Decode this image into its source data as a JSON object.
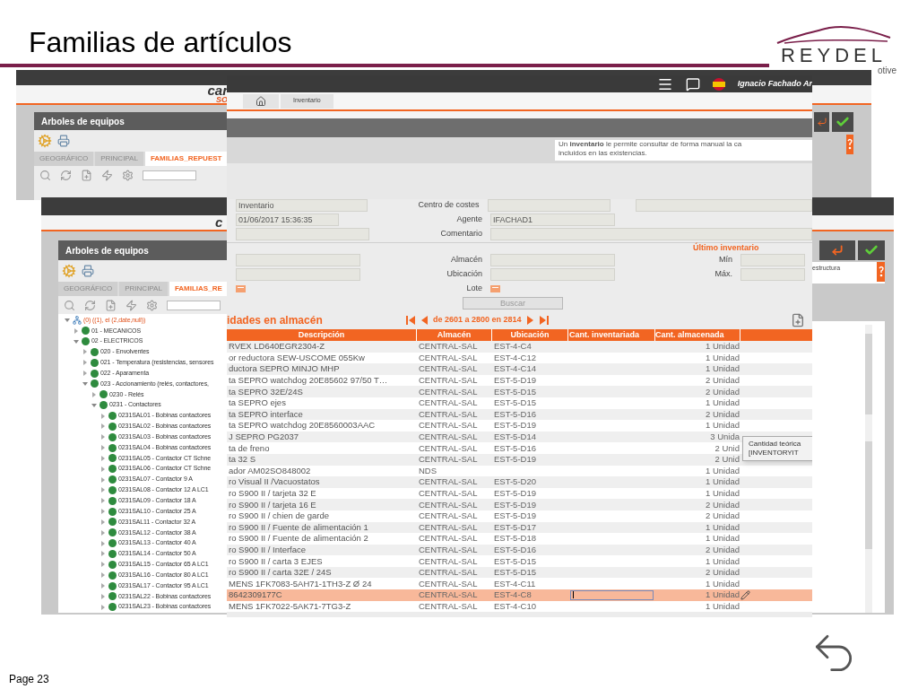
{
  "slide": {
    "title": "Familias de artículos",
    "logo": "REYDEL",
    "logo_tagline": "otive",
    "page": "Page 23"
  },
  "back_window_1": {
    "logo": "car",
    "logo_sub": "SO",
    "panel_title": "Arboles de equipos",
    "tabs": [
      {
        "label": "GEOGRÁFICO",
        "selected": false
      },
      {
        "label": "PRINCIPAL",
        "selected": false
      },
      {
        "label": "FAMILIAS_REPUEST",
        "selected": true
      }
    ]
  },
  "back_window_2": {
    "logo": "c",
    "panel_title": "Arboles de equipos",
    "side_text": "estructura",
    "tabs": [
      {
        "label": "GEOGRÁFICO",
        "selected": false
      },
      {
        "label": "PRINCIPAL",
        "selected": false
      },
      {
        "label": "FAMILIAS_RE",
        "selected": true
      }
    ],
    "tree": [
      {
        "label": "(0) ((1), el (2,date,null))",
        "kind": "root",
        "expanded": true,
        "children": [
          {
            "label": "01 - MECANICOS",
            "kind": "node",
            "expanded": false
          },
          {
            "label": "02 - ELECTRICOS",
            "kind": "node",
            "expanded": true,
            "children": [
              {
                "label": "020 - Envolventes",
                "kind": "node",
                "expanded": false
              },
              {
                "label": "021 - Temperatura (resistencias, sensores",
                "kind": "node",
                "expanded": false
              },
              {
                "label": "022 - Aparamenta",
                "kind": "node",
                "expanded": false
              },
              {
                "label": "023 - Accionamiento (relés, contactores,",
                "kind": "node",
                "expanded": true,
                "children": [
                  {
                    "label": "0230 - Relés",
                    "kind": "node",
                    "expanded": false
                  },
                  {
                    "label": "0231 - Contactores",
                    "kind": "node",
                    "expanded": true,
                    "children": [
                      {
                        "label": "0231SAL01 - Bobinas contactores",
                        "kind": "node",
                        "expanded": false
                      },
                      {
                        "label": "0231SAL02 - Bobinas contactores",
                        "kind": "node",
                        "expanded": false
                      },
                      {
                        "label": "0231SAL03 - Bobinas contactores",
                        "kind": "node",
                        "expanded": false
                      },
                      {
                        "label": "0231SAL04 - Bobinas contactores",
                        "kind": "node",
                        "expanded": false
                      },
                      {
                        "label": "0231SAL05 - Contactor CT Schne",
                        "kind": "node",
                        "expanded": false
                      },
                      {
                        "label": "0231SAL06 - Contactor CT Schne",
                        "kind": "node",
                        "expanded": false
                      },
                      {
                        "label": "0231SAL07 - Contactor 9 A",
                        "kind": "node",
                        "expanded": false
                      },
                      {
                        "label": "0231SAL08 - Contactor 12 A LC1",
                        "kind": "node",
                        "expanded": false
                      },
                      {
                        "label": "0231SAL09 - Contactor 18 A",
                        "kind": "node",
                        "expanded": false
                      },
                      {
                        "label": "0231SAL10 - Contactor 25 A",
                        "kind": "node",
                        "expanded": false
                      },
                      {
                        "label": "0231SAL11 - Contactor 32 A",
                        "kind": "node",
                        "expanded": false
                      },
                      {
                        "label": "0231SAL12 - Contactor 38 A",
                        "kind": "node",
                        "expanded": false
                      },
                      {
                        "label": "0231SAL13 - Contactor 40 A",
                        "kind": "node",
                        "expanded": false
                      },
                      {
                        "label": "0231SAL14 - Contactor 50 A",
                        "kind": "node",
                        "expanded": false
                      },
                      {
                        "label": "0231SAL15 - Contactor 65 A LC1",
                        "kind": "node",
                        "expanded": false
                      },
                      {
                        "label": "0231SAL16 - Contactor 80 A LC1",
                        "kind": "node",
                        "expanded": false
                      },
                      {
                        "label": "0231SAL17 - Contactor 95 A LC1",
                        "kind": "node",
                        "expanded": false
                      },
                      {
                        "label": "0231SAL22 - Bobinas contactores",
                        "kind": "node",
                        "expanded": false
                      },
                      {
                        "label": "0231SAL23 - Bobinas contactores",
                        "kind": "node",
                        "expanded": false
                      }
                    ]
                  }
                ]
              }
            ]
          }
        ]
      }
    ]
  },
  "inventory_window": {
    "user": "Ignacio Fachado Ar",
    "breadcrumb": "Inventario",
    "help_text": [
      "Un **inventario** le permite consultar de forma manual la ca",
      "incluidos en las existencias."
    ],
    "form": {
      "name": "Inventario",
      "date": "01/06/2017 15:36:35",
      "cost_center_label": "Centro de costes",
      "agent_label": "Agente",
      "agent": "IFACHAD1",
      "comment_label": "Comentario",
      "last_inventory_title": "Último inventario",
      "warehouse_label": "Almacén",
      "min_label": "Mín",
      "location_label": "Ubicación",
      "max_label": "Máx.",
      "lot_label": "Lote",
      "search_button": "Buscar"
    },
    "results_title": "idades en almacén",
    "pager": "de 2601 a 2800 en 2814",
    "columns": [
      "Descripción",
      "Almacén",
      "Ubicación",
      "Cant. inventariada",
      "Cant. almacenada"
    ],
    "rows": [
      {
        "description": "RVEX LD640EGR2304-Z",
        "warehouse": "CENTRAL-SAL",
        "location": "EST-4-C4",
        "stored": "1 Unidad",
        "selected": false
      },
      {
        "description": "or reductora SEW-USCOME 055Kw",
        "warehouse": "CENTRAL-SAL",
        "location": "EST-4-C12",
        "stored": "1 Unidad",
        "selected": false
      },
      {
        "description": "ductora SEPRO MINJO MHP",
        "warehouse": "CENTRAL-SAL",
        "location": "EST-4-C14",
        "stored": "1 Unidad",
        "selected": false
      },
      {
        "description": "ta SEPRO watchdog 20E85602 97/50 T…",
        "warehouse": "CENTRAL-SAL",
        "location": "EST-5-D19",
        "stored": "2 Unidad",
        "selected": false
      },
      {
        "description": "ta SEPRO 32E/24S",
        "warehouse": "CENTRAL-SAL",
        "location": "EST-5-D15",
        "stored": "2 Unidad",
        "selected": false
      },
      {
        "description": "ta SEPRO ejes",
        "warehouse": "CENTRAL-SAL",
        "location": "EST-5-D15",
        "stored": "1 Unidad",
        "selected": false
      },
      {
        "description": "ta SEPRO interface",
        "warehouse": "CENTRAL-SAL",
        "location": "EST-5-D16",
        "stored": "2 Unidad",
        "selected": false
      },
      {
        "description": "ta SEPRO watchdog 20E8560003AAC",
        "warehouse": "CENTRAL-SAL",
        "location": "EST-5-D19",
        "stored": "1 Unidad",
        "selected": false
      },
      {
        "description": "J SEPRO PG2037",
        "warehouse": "CENTRAL-SAL",
        "location": "EST-5-D14",
        "stored": "3 Unida",
        "selected": false
      },
      {
        "description": "ta de freno",
        "warehouse": "CENTRAL-SAL",
        "location": "EST-5-D16",
        "stored": "2 Unid",
        "selected": false
      },
      {
        "description": "ta 32 S",
        "warehouse": "CENTRAL-SAL",
        "location": "EST-5-D19",
        "stored": "2 Unid",
        "selected": false
      },
      {
        "description": "ador AM02SO848002",
        "warehouse": "NDS",
        "location": "",
        "stored": "1 Unidad",
        "selected": false
      },
      {
        "description": "ro Visual II /Vacuostatos",
        "warehouse": "CENTRAL-SAL",
        "location": "EST-5-D20",
        "stored": "1 Unidad",
        "selected": false
      },
      {
        "description": "ro S900 II / tarjeta 32 E",
        "warehouse": "CENTRAL-SAL",
        "location": "EST-5-D19",
        "stored": "1 Unidad",
        "selected": false
      },
      {
        "description": "ro S900 II / tarjeta 16 E",
        "warehouse": "CENTRAL-SAL",
        "location": "EST-5-D19",
        "stored": "2 Unidad",
        "selected": false
      },
      {
        "description": "ro S900 II / chien de garde",
        "warehouse": "CENTRAL-SAL",
        "location": "EST-5-D19",
        "stored": "2 Unidad",
        "selected": false
      },
      {
        "description": "ro S900 II / Fuente de alimentación 1",
        "warehouse": "CENTRAL-SAL",
        "location": "EST-5-D17",
        "stored": "1 Unidad",
        "selected": false
      },
      {
        "description": "ro S900 II / Fuente de alimentación 2",
        "warehouse": "CENTRAL-SAL",
        "location": "EST-5-D18",
        "stored": "1 Unidad",
        "selected": false
      },
      {
        "description": "ro S900 II / Interface",
        "warehouse": "CENTRAL-SAL",
        "location": "EST-5-D16",
        "stored": "2 Unidad",
        "selected": false
      },
      {
        "description": "ro S900 II / carta 3 EJES",
        "warehouse": "CENTRAL-SAL",
        "location": "EST-5-D15",
        "stored": "1 Unidad",
        "selected": false
      },
      {
        "description": "ro S900 II / carta 32E / 24S",
        "warehouse": "CENTRAL-SAL",
        "location": "EST-5-D15",
        "stored": "2 Unidad",
        "selected": false
      },
      {
        "description": "MENS 1FK7083-5AH71-1TH3-Z Ø 24",
        "warehouse": "CENTRAL-SAL",
        "location": "EST-4-C11",
        "stored": "1 Unidad",
        "selected": false
      },
      {
        "description": "8642309177C",
        "warehouse": "CENTRAL-SAL",
        "location": "EST-4-C8",
        "stored": "1 Unidad",
        "selected": true
      },
      {
        "description": "MENS 1FK7022-5AK71-7TG3-Z",
        "warehouse": "CENTRAL-SAL",
        "location": "EST-4-C10",
        "stored": "1 Unidad",
        "selected": false
      }
    ],
    "tooltip": [
      "Cantidad teórica",
      "[INVENTORYIT"
    ]
  }
}
